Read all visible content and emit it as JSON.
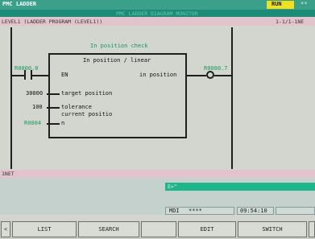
{
  "header": {
    "app_title": "PMC LADDER",
    "run_status": "RUN",
    "run_indicator": "**",
    "monitor_title": "PMC LADDER DIAGRAM MONITOR",
    "program_label": "LEVEL1 (LADDER PROGRAM (LEVEL1))",
    "page_indicator": "1-1/1-1NE"
  },
  "ladder": {
    "rung_title": "In position check",
    "block_title": "In position / linear",
    "input_contact_address": "R0000.0",
    "output_coil_address": "R0000.7",
    "pins": {
      "en": "EN",
      "target": "target position",
      "tolerance_1": "tolerance",
      "tolerance_2": "current positio",
      "n": "n",
      "out": "in position"
    },
    "values": {
      "target_value": "30000",
      "tolerance_value": "100",
      "n_address": "R0004"
    }
  },
  "net_label": "1NET",
  "input_line": {
    "prompt": "E>^"
  },
  "status": {
    "mode": "MDI",
    "mode_stars": "****",
    "time": "09:54:10"
  },
  "softkeys": {
    "prev": "<",
    "list": "LIST",
    "search": "SEARCH",
    "edit": "EDIT",
    "switch": "SWITCH"
  },
  "colors": {
    "title_bar": "#3aa08a",
    "run_badge": "#f0e020",
    "green_label": "#159a5e",
    "input_field": "#1fb489"
  }
}
